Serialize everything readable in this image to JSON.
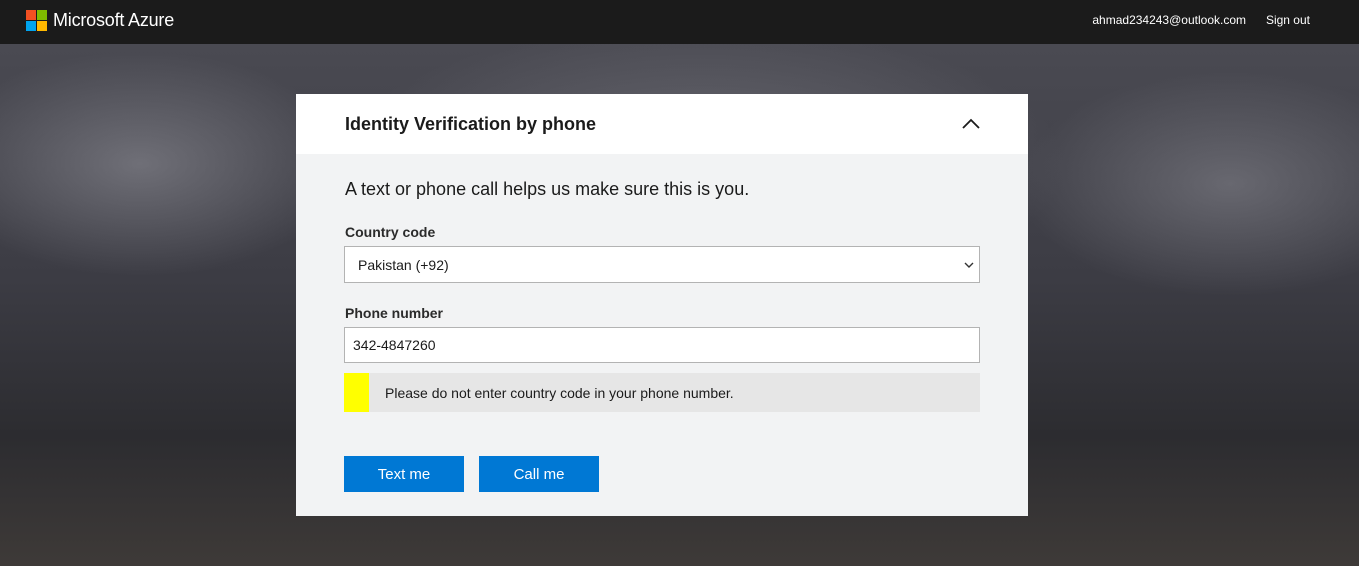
{
  "header": {
    "brand": "Microsoft Azure",
    "account": "ahmad234243@outlook.com",
    "sign_out": "Sign out",
    "logo_colors": [
      "#f25022",
      "#7fba00",
      "#00a4ef",
      "#ffb900"
    ]
  },
  "card": {
    "title": "Identity Verification by phone",
    "collapse_icon": "chevron-up-icon",
    "lead": "A text or phone call helps us make sure this is you.",
    "country_code": {
      "label": "Country code",
      "value": "Pakistan (+92)"
    },
    "phone_number": {
      "label": "Phone number",
      "value": "342-4847260"
    },
    "note": "Please do not enter country code in your phone number.",
    "buttons": {
      "text_me": "Text me",
      "call_me": "Call me"
    }
  },
  "colors": {
    "accent": "#0078d4",
    "note_highlight": "#ffff00",
    "topbar": "#1b1b1b"
  }
}
